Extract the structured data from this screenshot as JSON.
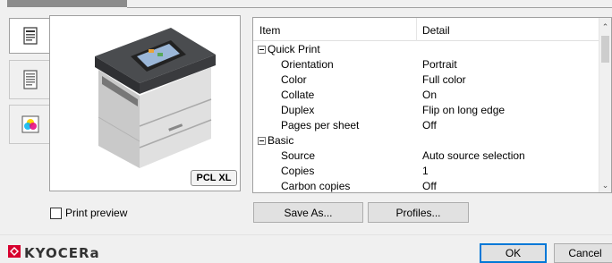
{
  "preview": {
    "pdl_badge": "PCL XL"
  },
  "table": {
    "columns": {
      "item": "Item",
      "detail": "Detail"
    },
    "rows": [
      {
        "item": "Quick Print",
        "detail": "",
        "group": true
      },
      {
        "item": "Orientation",
        "detail": "Portrait"
      },
      {
        "item": "Color",
        "detail": "Full color"
      },
      {
        "item": "Collate",
        "detail": "On"
      },
      {
        "item": "Duplex",
        "detail": "Flip on long edge"
      },
      {
        "item": "Pages per sheet",
        "detail": "Off"
      },
      {
        "item": "Basic",
        "detail": "",
        "group": true
      },
      {
        "item": "Source",
        "detail": "Auto source selection"
      },
      {
        "item": "Copies",
        "detail": "1"
      },
      {
        "item": "Carbon copies",
        "detail": "Off"
      }
    ]
  },
  "print_preview": {
    "label": "Print preview",
    "checked": false
  },
  "buttons": {
    "save_as": "Save As...",
    "profiles": "Profiles...",
    "ok": "OK",
    "cancel": "Cancel"
  },
  "brand": {
    "logo_text": "KYOCERa",
    "logo_color": "#d7002e"
  },
  "icons": {
    "tab1": "quick-print-icon",
    "tab2": "document-icon",
    "tab3": "color-ink-icon"
  },
  "colors": {
    "accent": "#0078d7"
  }
}
